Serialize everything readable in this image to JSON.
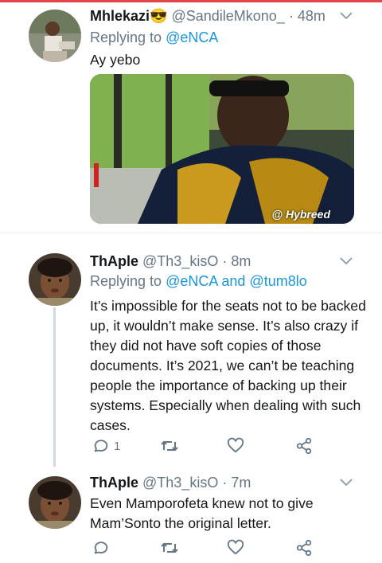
{
  "colors": {
    "accent": "#1b95e0",
    "muted": "#657786",
    "text": "#14171a",
    "divider": "#e6ecf0"
  },
  "tweets": [
    {
      "name": "Mhlekazi😎",
      "handle": "@SandileMkono_",
      "time": "48m",
      "replying_prefix": "Replying to",
      "replying_to": [
        "@eNCA"
      ],
      "replying_joiner": "",
      "text": "Ay yebo",
      "media_watermark": "@ Hybreed",
      "actions": {
        "reply_count": "",
        "retweet_count": "",
        "like_count": ""
      }
    },
    {
      "name": "ThAple",
      "handle": "@Th3_kisO",
      "time": "8m",
      "replying_prefix": "Replying to",
      "replying_to": [
        "@eNCA",
        "@tum8lo"
      ],
      "replying_joiner": "and",
      "text": "It’s impossible for the seats not to be backed up, it wouldn’t make sense. It’s also crazy if they did not have soft copies of those documents. It’s 2021, we can’t be teaching people the importance of backing up their systems. Especially when dealing with such cases.",
      "actions": {
        "reply_count": "1",
        "retweet_count": "",
        "like_count": ""
      }
    },
    {
      "name": "ThAple",
      "handle": "@Th3_kisO",
      "time": "7m",
      "text": "Even Mamporofeta knew not to give Mam’Sonto the original letter.",
      "actions": {
        "reply_count": "",
        "retweet_count": "",
        "like_count": ""
      }
    }
  ],
  "separator": "·",
  "icons": [
    "reply-icon",
    "retweet-icon",
    "like-icon",
    "share-icon",
    "chevron-down-icon"
  ]
}
